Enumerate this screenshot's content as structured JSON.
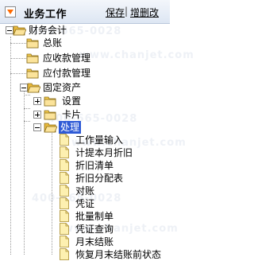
{
  "header": {
    "title": "业务工作",
    "save_label": "保存",
    "separator": "|",
    "add_delete_label": "增删改"
  },
  "tree": {
    "root": "财务会计",
    "general_ledger": "总账",
    "receivables": "应收款管理",
    "payables": "应付款管理",
    "fixed_assets": "固定资产",
    "settings": "设置",
    "cards": "卡片",
    "processing": "处理",
    "processing_items": [
      "工作量输入",
      "计提本月折旧",
      "折旧清单",
      "折旧分配表",
      "对账",
      "凭证",
      "批量制单",
      "凭证查询",
      "月末结账",
      "恢复月末结账前状态"
    ]
  },
  "watermark": {
    "phone": "400-665-0028",
    "site": "www.chanjet.com"
  },
  "colors": {
    "selection": "#2f5bd6",
    "folder": "#f2c94c",
    "header_bg": "#dde6f3"
  }
}
